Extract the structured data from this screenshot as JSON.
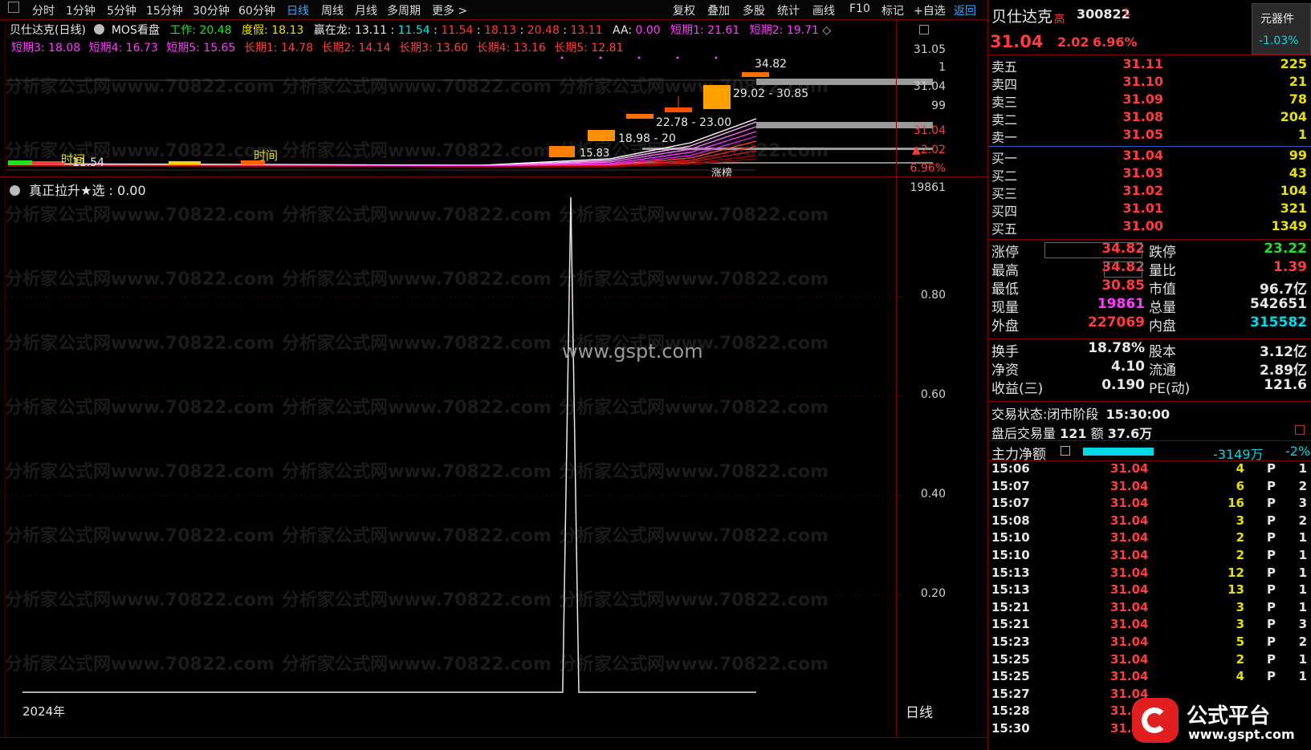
{
  "toolbar": {
    "tabs": [
      "分时",
      "1分钟",
      "5分钟",
      "15分钟",
      "30分钟",
      "60分钟",
      "日线",
      "周线",
      "月线",
      "多周期",
      "更多 >"
    ],
    "actions": [
      "复权",
      "叠加",
      "多股",
      "统计",
      "画线",
      "F10",
      "标记",
      "+自选",
      "返回"
    ]
  },
  "indicator_main": {
    "name": "贝仕达克(日线)",
    "formula": "MOS看盘",
    "work_label": "工作:",
    "work_value": "20.48",
    "fake_label": "度假:",
    "fake_value": "18.13",
    "win_label": "赢在龙:",
    "win_values": [
      "13.11",
      "11.54",
      "11.54",
      "18.13",
      "20.48",
      "13.11"
    ],
    "aa_label": "AA:",
    "aa_value": "0.00",
    "short1": "短期1: 21.61",
    "short2": "短期2: 19.71",
    "short3": "短期3: 18.08",
    "short4": "短期4: 16.73",
    "short5": "短期5: 15.65",
    "long1": "长期1: 14.78",
    "long2": "长期2: 14.14",
    "long3": "长期3: 13.60",
    "long4": "长期4: 13.16",
    "long5": "长期5: 12.81"
  },
  "kline_annotations": {
    "high_label": "34.82",
    "range1": "29.02 - 30.85",
    "range2": "22.78 - 23.00",
    "range3": "18.98 - 20",
    "range4": "15.83",
    "time_label": "时间",
    "low_label": "11.54",
    "zt_label": "涨榜"
  },
  "top_axis": [
    "31.05",
    "1",
    "31.04",
    "99",
    "31.04",
    "▲2.02",
    "6.96%"
  ],
  "indicator_sub": {
    "name": "真正拉升★选",
    "value": ": 0.00",
    "axis": [
      "19861",
      "0.80",
      "0.60",
      "0.40",
      "0.20"
    ],
    "chart_data": {
      "type": "line",
      "series": [
        {
          "values": [
            0,
            0,
            0,
            0,
            0,
            0,
            0,
            0,
            0,
            0,
            0,
            0,
            0,
            0,
            0,
            0,
            0,
            0,
            0,
            0,
            0,
            0,
            0,
            0,
            0,
            0,
            0,
            0,
            0,
            0,
            0,
            0,
            0,
            0,
            0,
            0,
            0,
            0,
            0,
            0,
            0,
            0,
            0,
            0,
            0,
            0,
            0,
            0,
            0,
            0,
            0,
            0,
            0,
            0,
            0,
            0,
            0,
            0,
            0,
            0,
            0,
            0,
            0,
            0,
            0,
            0,
            0,
            0,
            1,
            0,
            0,
            0,
            0,
            0,
            0,
            0,
            0,
            0,
            0,
            0,
            0,
            0,
            0,
            0,
            0,
            0,
            0,
            0,
            0,
            0,
            0,
            0
          ]
        }
      ],
      "ylim": [
        0,
        1
      ]
    }
  },
  "bottom_labels": {
    "year": "2024年",
    "period": "日线"
  },
  "center_watermark": "www.gspt.com",
  "watermark_text": "分析家公式网www.70822.com",
  "quote": {
    "name": "贝仕达克",
    "name_mark": "高",
    "code": "300822",
    "code_mark": "L",
    "top_btn": "元器件",
    "top_btn_pct": "-1.03%",
    "price": "31.04",
    "change": "2.02",
    "change_pct": "6.96%",
    "asks": [
      {
        "label": "卖五",
        "price": "31.11",
        "vol": "225"
      },
      {
        "label": "卖四",
        "price": "31.10",
        "vol": "21"
      },
      {
        "label": "卖三",
        "price": "31.09",
        "vol": "78"
      },
      {
        "label": "卖二",
        "price": "31.08",
        "vol": "204"
      },
      {
        "label": "卖一",
        "price": "31.05",
        "vol": "1"
      }
    ],
    "bids": [
      {
        "label": "买一",
        "price": "31.04",
        "vol": "99"
      },
      {
        "label": "买二",
        "price": "31.03",
        "vol": "43"
      },
      {
        "label": "买三",
        "price": "31.02",
        "vol": "104"
      },
      {
        "label": "买四",
        "price": "31.01",
        "vol": "321"
      },
      {
        "label": "买五",
        "price": "31.00",
        "vol": "1349"
      }
    ],
    "stats1": [
      {
        "l1": "涨停",
        "v1": "34.82",
        "l2": "跌停",
        "v2": "23.22"
      },
      {
        "l1": "最高",
        "v1": "34.82",
        "l2": "量比",
        "v2": "1.39"
      },
      {
        "l1": "最低",
        "v1": "30.85",
        "l2": "市值",
        "v2": "96.7亿"
      },
      {
        "l1": "现量",
        "v1": "19861",
        "l2": "总量",
        "v2": "542651"
      },
      {
        "l1": "外盘",
        "v1": "227069",
        "l2": "内盘",
        "v2": "315582"
      }
    ],
    "stats2": [
      {
        "l1": "换手",
        "v1": "18.78%",
        "l2": "股本",
        "v2": "3.12亿"
      },
      {
        "l1": "净资",
        "v1": "4.10",
        "l2": "流通",
        "v2": "2.89亿"
      },
      {
        "l1": "收益(三)",
        "v1": "0.190",
        "l2": "PE(动)",
        "v2": "121.6"
      }
    ],
    "trade_state_label": "交易状态:",
    "trade_state": "闭市阶段",
    "trade_time": "15:30:00",
    "after_label": "盘后交易量",
    "after_vol": "121",
    "after_amt_label": "额",
    "after_amt": "37.6万",
    "main_net_label": "主力净额",
    "main_net": "-3149万",
    "main_net_pct": "-2%",
    "ticks": [
      {
        "t": "15:06",
        "p": "31.04",
        "v": "4",
        "f": "P",
        "n": "1"
      },
      {
        "t": "15:07",
        "p": "31.04",
        "v": "6",
        "f": "P",
        "n": "2"
      },
      {
        "t": "15:07",
        "p": "31.04",
        "v": "16",
        "f": "P",
        "n": "3"
      },
      {
        "t": "15:08",
        "p": "31.04",
        "v": "3",
        "f": "P",
        "n": "2"
      },
      {
        "t": "15:10",
        "p": "31.04",
        "v": "2",
        "f": "P",
        "n": "1"
      },
      {
        "t": "15:10",
        "p": "31.04",
        "v": "2",
        "f": "P",
        "n": "1"
      },
      {
        "t": "15:13",
        "p": "31.04",
        "v": "12",
        "f": "P",
        "n": "1"
      },
      {
        "t": "15:13",
        "p": "31.04",
        "v": "13",
        "f": "P",
        "n": "1"
      },
      {
        "t": "15:21",
        "p": "31.04",
        "v": "3",
        "f": "P",
        "n": "1"
      },
      {
        "t": "15:21",
        "p": "31.04",
        "v": "3",
        "f": "P",
        "n": "3"
      },
      {
        "t": "15:23",
        "p": "31.04",
        "v": "5",
        "f": "P",
        "n": "2"
      },
      {
        "t": "15:25",
        "p": "31.04",
        "v": "2",
        "f": "P",
        "n": "1"
      },
      {
        "t": "15:25",
        "p": "31.04",
        "v": "4",
        "f": "P",
        "n": "1"
      },
      {
        "t": "15:27",
        "p": "31.04",
        "v": "",
        "f": "",
        "n": ""
      },
      {
        "t": "15:28",
        "p": "31.04",
        "v": "",
        "f": "",
        "n": ""
      },
      {
        "t": "15:30",
        "p": "31.04",
        "v": "",
        "f": "",
        "n": ""
      }
    ]
  },
  "logo": {
    "cn": "公式平台",
    "en": "www.gspt.com"
  },
  "colors": {
    "up": "#ff3b3b",
    "volume": "#e8e000",
    "cyan": "#00d8e8",
    "magenta": "#ff3bff",
    "border": "#7a0000"
  }
}
